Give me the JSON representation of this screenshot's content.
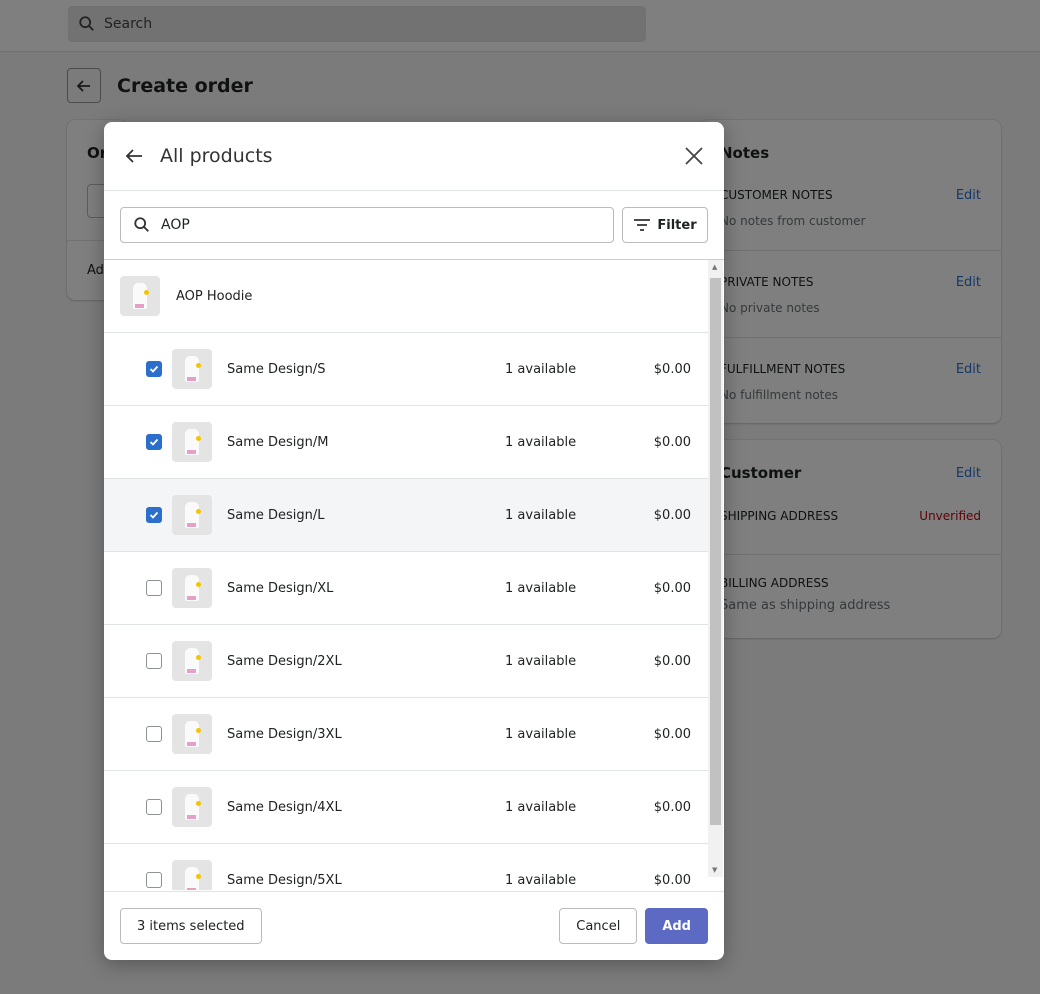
{
  "topbar": {
    "search_placeholder": "Search"
  },
  "page": {
    "title": "Create order"
  },
  "left_card": {
    "title": "Or",
    "add": "Ad"
  },
  "notes": {
    "title": "Notes",
    "sections": [
      {
        "label": "Customer notes",
        "text": "No notes from customer",
        "edit": "Edit"
      },
      {
        "label": "Private notes",
        "text": "No private notes",
        "edit": "Edit"
      },
      {
        "label": "Fulfillment notes",
        "text": "No fulfillment notes",
        "edit": "Edit"
      }
    ]
  },
  "customer": {
    "title": "Customer",
    "edit": "Edit",
    "shipping_label": "Shipping address",
    "shipping_status": "Unverified",
    "billing_label": "Billing address",
    "billing_text": "Same as shipping address"
  },
  "modal": {
    "title": "All products",
    "search_value": "AOP",
    "filter_label": "Filter",
    "product": {
      "name": "AOP Hoodie"
    },
    "variants": [
      {
        "name": "Same Design/S",
        "available": "1 available",
        "price": "$0.00",
        "checked": true
      },
      {
        "name": "Same Design/M",
        "available": "1 available",
        "price": "$0.00",
        "checked": true
      },
      {
        "name": "Same Design/L",
        "available": "1 available",
        "price": "$0.00",
        "checked": true
      },
      {
        "name": "Same Design/XL",
        "available": "1 available",
        "price": "$0.00",
        "checked": false
      },
      {
        "name": "Same Design/2XL",
        "available": "1 available",
        "price": "$0.00",
        "checked": false
      },
      {
        "name": "Same Design/3XL",
        "available": "1 available",
        "price": "$0.00",
        "checked": false
      },
      {
        "name": "Same Design/4XL",
        "available": "1 available",
        "price": "$0.00",
        "checked": false
      },
      {
        "name": "Same Design/5XL",
        "available": "1 available",
        "price": "$0.00",
        "checked": false
      }
    ],
    "selected_count": "3 items selected",
    "cancel": "Cancel",
    "add": "Add"
  },
  "colors": {
    "accent": "#5c6ac4",
    "checkbox": "#2c6ecb",
    "unverified": "#bf0711"
  }
}
